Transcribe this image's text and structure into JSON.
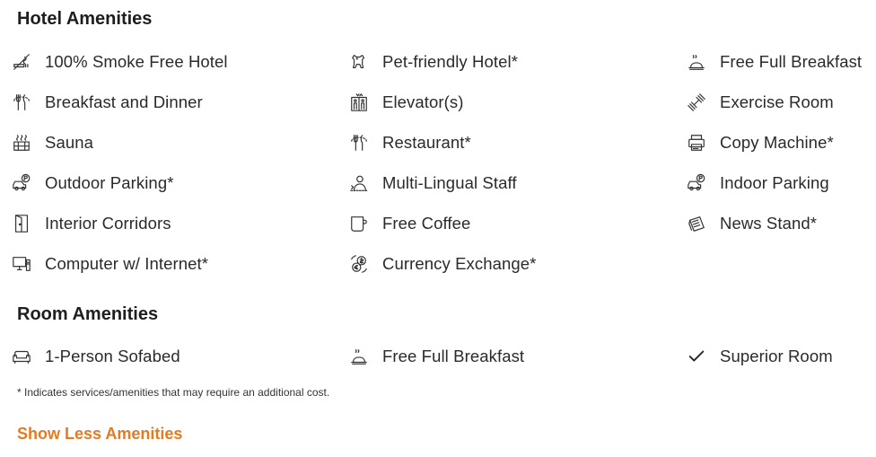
{
  "hotel_amenities": {
    "title": "Hotel Amenities",
    "rows": [
      [
        {
          "label": "100% Smoke Free Hotel",
          "icon": "no-smoking-icon"
        },
        {
          "label": "Pet-friendly Hotel*",
          "icon": "dog-icon"
        },
        {
          "label": "Free Full Breakfast",
          "icon": "breakfast-icon"
        }
      ],
      [
        {
          "label": "Breakfast and Dinner",
          "icon": "fork-knife-icon"
        },
        {
          "label": "Elevator(s)",
          "icon": "elevator-icon"
        },
        {
          "label": "Exercise Room",
          "icon": "dumbbell-icon"
        }
      ],
      [
        {
          "label": "Sauna",
          "icon": "sauna-icon"
        },
        {
          "label": "Restaurant*",
          "icon": "fork-knife-icon"
        },
        {
          "label": "Copy Machine*",
          "icon": "printer-icon"
        }
      ],
      [
        {
          "label": "Outdoor Parking*",
          "icon": "parking-icon"
        },
        {
          "label": "Multi-Lingual Staff",
          "icon": "staff-icon"
        },
        {
          "label": "Indoor Parking",
          "icon": "parking-icon"
        }
      ],
      [
        {
          "label": "Interior Corridors",
          "icon": "door-icon"
        },
        {
          "label": "Free Coffee",
          "icon": "coffee-cup-icon"
        },
        {
          "label": "News Stand*",
          "icon": "newspaper-icon"
        }
      ],
      [
        {
          "label": "Computer w/ Internet*",
          "icon": "computer-icon"
        },
        {
          "label": "Currency Exchange*",
          "icon": "currency-exchange-icon"
        }
      ]
    ]
  },
  "room_amenities": {
    "title": "Room Amenities",
    "rows": [
      [
        {
          "label": "1-Person Sofabed",
          "icon": "sofa-icon"
        },
        {
          "label": "Free Full Breakfast",
          "icon": "breakfast-icon"
        },
        {
          "label": "Superior Room",
          "icon": "checkmark-icon"
        }
      ]
    ]
  },
  "footnote": "* Indicates services/amenities that may require an additional cost.",
  "toggle_link": "Show Less Amenities",
  "colors": {
    "accent": "#e57a21",
    "text": "#222222",
    "icon": "#333333"
  }
}
